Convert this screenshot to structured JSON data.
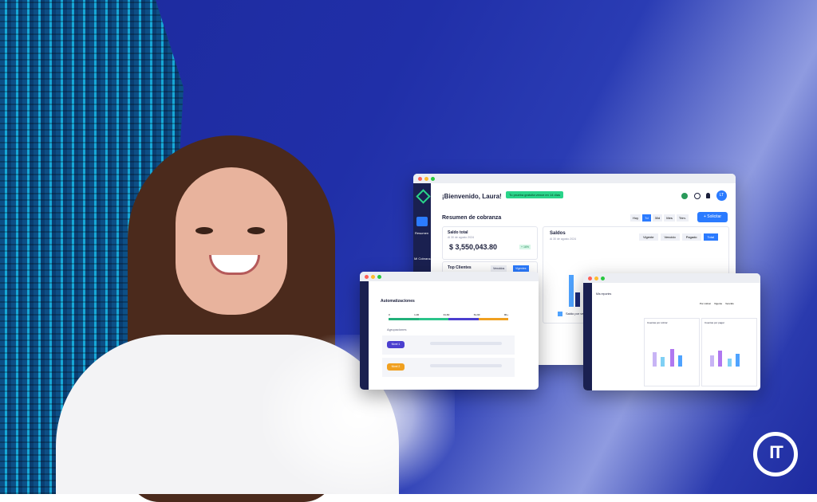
{
  "dashboard": {
    "greeting": "¡Bienvenido, Laura!",
    "notice": "Tu prueba gratuita vence en 14 días",
    "section_title": "Resumen de cobranza",
    "avatar_initials": "LT",
    "new_button": "+ Solicitar",
    "sidebar_items": [
      "Resumen",
      "Mi Cobranza",
      "Ventas"
    ],
    "date_filters": [
      "Hoy",
      "7d",
      "30d",
      "Mes",
      "Trim."
    ],
    "total_balance": {
      "title": "Saldo total",
      "subtitle": "Al 30 de agosto 2024",
      "value": "$ 3,550,043.80",
      "badge": "+ 16%"
    },
    "top_clients": {
      "title": "Top Clientes",
      "tabs": [
        "Vencidos",
        "Vigentes"
      ]
    },
    "balances": {
      "title": "Saldos",
      "subtitle": "Al 30 de agosto 2024",
      "tabs": [
        "Vigente",
        "Vencido",
        "Pagado",
        "Total"
      ],
      "legend": "Saldo por vencer"
    }
  },
  "automation_window": {
    "title": "Automatizaciones",
    "scale_labels": [
      "0",
      "1-30",
      "31-60",
      "61-90",
      "90+"
    ],
    "subtitle": "Agrupaciones",
    "rows": [
      {
        "tag": "Nivel 1",
        "color": "#4b3fcf"
      },
      {
        "tag": "Nivel 2",
        "color": "#f0a020"
      }
    ]
  },
  "report_window": {
    "title": "Mis reportes",
    "panels": [
      "Cuentas por cobrar",
      "Cuentas por pagar"
    ],
    "legend": [
      "Por cobrar",
      "Vigente",
      "Vencido"
    ]
  },
  "brand": {
    "logo": "IT",
    "accent": "#2b7bff",
    "success": "#2ad48a"
  }
}
